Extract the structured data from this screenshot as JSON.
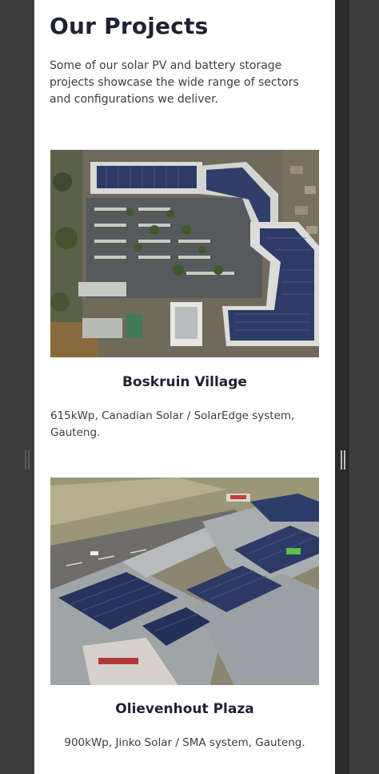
{
  "page": {
    "title": "Our Projects",
    "intro": "Some of our solar PV and battery storage projects showcase the wide range of sectors and configurations we deliver."
  },
  "projects": [
    {
      "name": "Boskruin Village",
      "description": "615kWp, Canadian Solar / SolarEdge system, Gauteng."
    },
    {
      "name": "Olievenhout Plaza",
      "description": "900kWp, Jinko Solar / SMA system, Gauteng."
    }
  ],
  "colors": {
    "panel_background": "#ffffff",
    "page_background": "#3b3b3b",
    "heading_text": "#1f2233",
    "body_text": "#3a3d4a",
    "solar_panel": "#2c3b63"
  }
}
